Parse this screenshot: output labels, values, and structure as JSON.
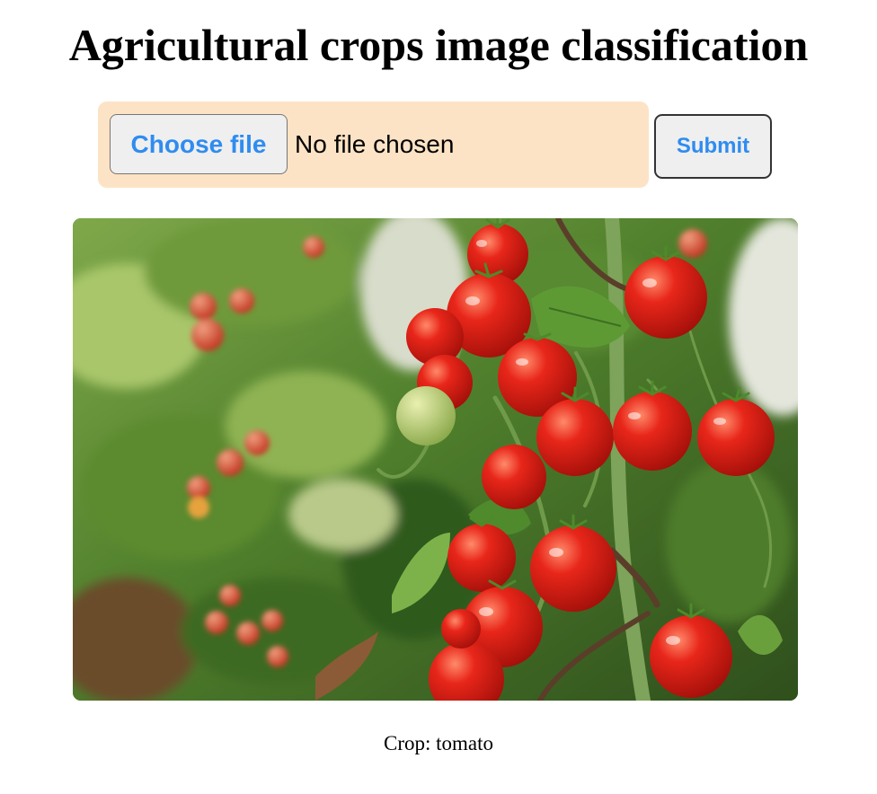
{
  "page": {
    "title": "Agricultural crops image classification"
  },
  "upload": {
    "choose_label": "Choose file",
    "status": "No file chosen",
    "submit_label": "Submit"
  },
  "image": {
    "subject": "tomato plants"
  },
  "result": {
    "text": "Crop: tomato"
  },
  "colors": {
    "upload_box": "#fde3c5",
    "button_text": "#2f8cf0",
    "button_bg": "#efefef"
  }
}
